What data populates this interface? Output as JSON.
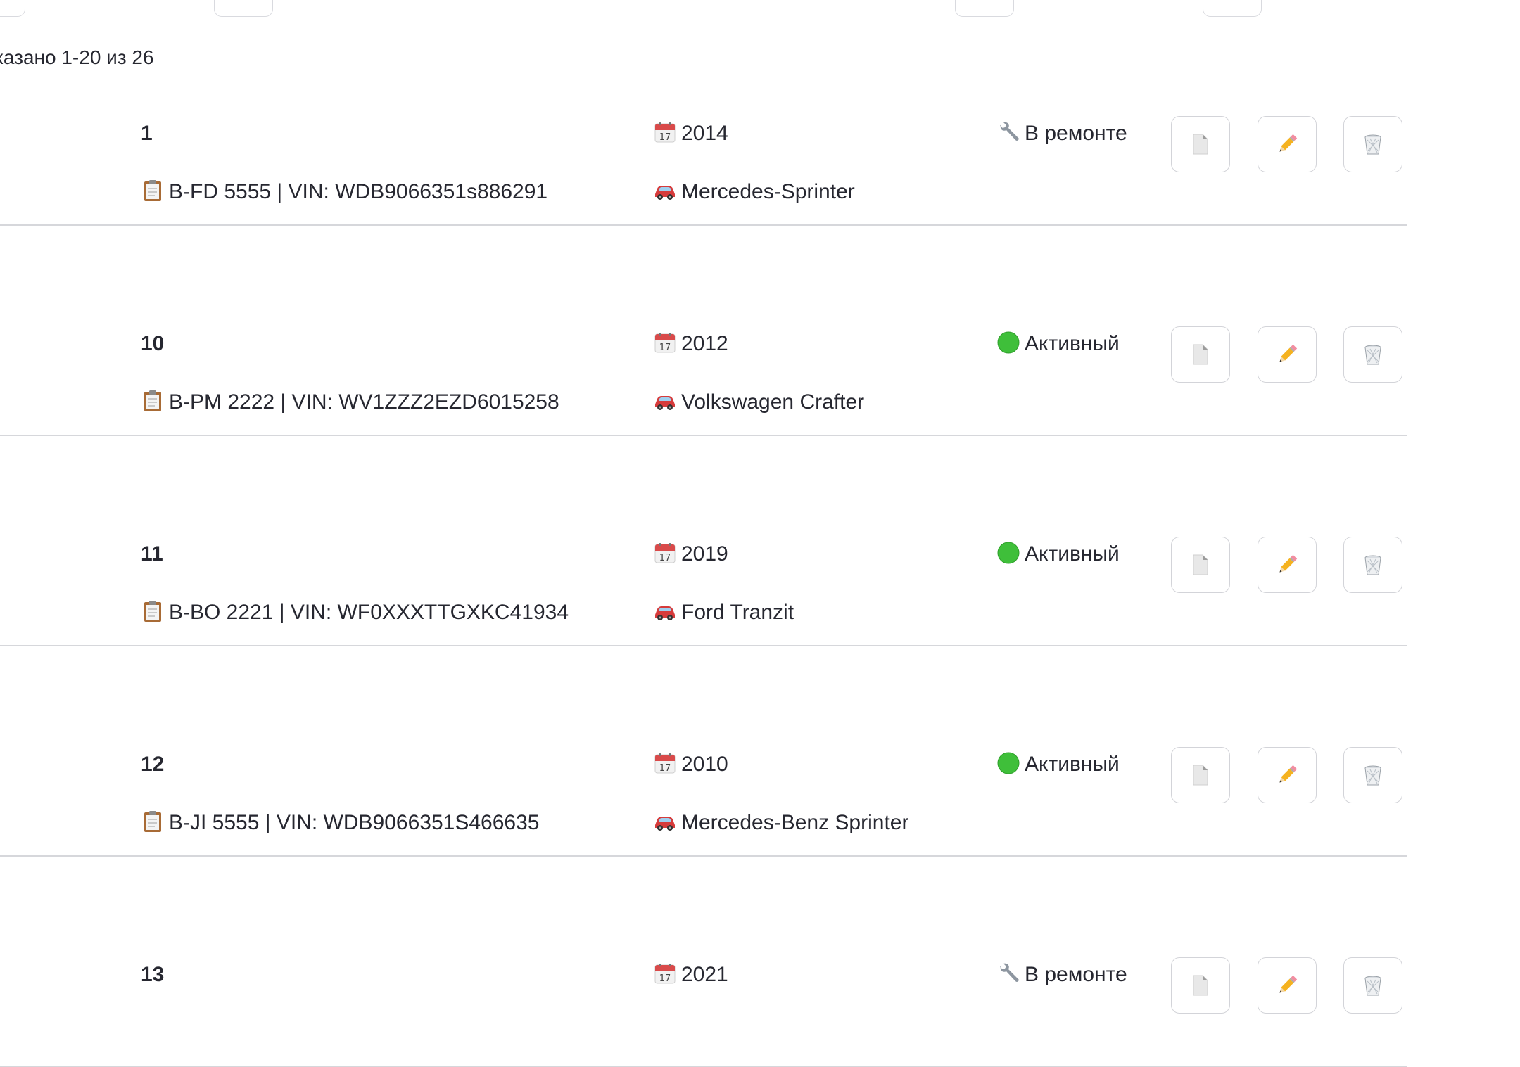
{
  "summary": "казано 1-20 из 26",
  "rows": [
    {
      "id": "1",
      "plate": "B-FD 5555 | VIN: WDB9066351s886291",
      "year": "2014",
      "model": "Mercedes-Sprinter",
      "status": "В ремонте",
      "status_icon": "wrench-icon"
    },
    {
      "id": "10",
      "plate": "B-PM 2222 | VIN: WV1ZZZ2EZD6015258",
      "year": "2012",
      "model": "Volkswagen Crafter",
      "status": "Активный",
      "status_icon": "green-circle-icon"
    },
    {
      "id": "11",
      "plate": "B-BO 2221 | VIN: WF0XXXTTGXKC41934",
      "year": "2019",
      "model": "Ford Tranzit",
      "status": "Активный",
      "status_icon": "green-circle-icon"
    },
    {
      "id": "12",
      "plate": "B-JI 5555 | VIN: WDB9066351S466635",
      "year": "2010",
      "model": "Mercedes-Benz Sprinter",
      "status": "Активный",
      "status_icon": "green-circle-icon"
    },
    {
      "id": "13",
      "plate": "",
      "year": "2021",
      "model": "",
      "status": "В ремонте",
      "status_icon": "wrench-icon"
    }
  ],
  "icons": {
    "plate": "clipboard-icon",
    "year": "calendar-icon",
    "model": "car-icon",
    "doc_button": "document-icon",
    "edit_button": "pencil-icon",
    "delete_button": "trash-icon"
  },
  "colors": {
    "status_active": "#3fbf3a",
    "divider": "#d6d7db",
    "text": "#262730"
  }
}
